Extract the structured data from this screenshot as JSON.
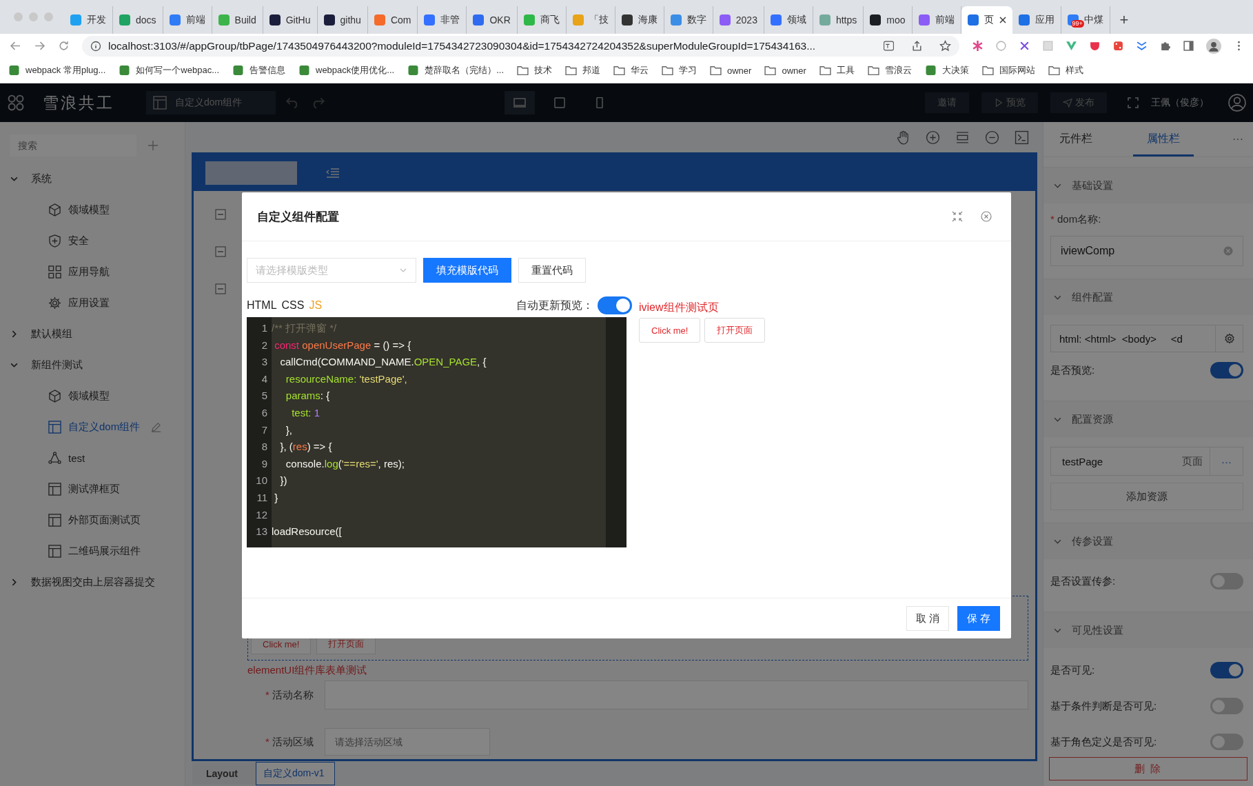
{
  "browser": {
    "tabs": [
      {
        "label": "开发",
        "selected": false,
        "color": "#1ea1f1"
      },
      {
        "label": "docs",
        "selected": false,
        "color": "#1fa463"
      },
      {
        "label": "前端",
        "selected": false,
        "color": "#2f7cf6"
      },
      {
        "label": "Build",
        "selected": false,
        "color": "#3cb44a"
      },
      {
        "label": "GitHu",
        "selected": false,
        "color": "#1b1f3b"
      },
      {
        "label": "githu",
        "selected": false,
        "color": "#1b1f3b"
      },
      {
        "label": "Com",
        "selected": false,
        "color": "#f56b2a"
      },
      {
        "label": "非管",
        "selected": false,
        "color": "#3370ff"
      },
      {
        "label": "OKR",
        "selected": false,
        "color": "#2e6bf0"
      },
      {
        "label": "商飞",
        "selected": false,
        "color": "#2fb84a"
      },
      {
        "label": "「技",
        "selected": false,
        "color": "#e8a317"
      },
      {
        "label": "海康",
        "selected": false,
        "color": "#333333"
      },
      {
        "label": "数字",
        "selected": false,
        "color": "#3a8ee6"
      },
      {
        "label": "2023",
        "selected": false,
        "color": "#8b5cf6"
      },
      {
        "label": "领域",
        "selected": false,
        "color": "#3370ff"
      },
      {
        "label": "https",
        "selected": false,
        "color": "#74aa9c"
      },
      {
        "label": "moo",
        "selected": false,
        "color": "#1b1f23"
      },
      {
        "label": "前端",
        "selected": false,
        "color": "#8b5cf6"
      },
      {
        "label": "页",
        "selected": true,
        "color": "#1f6fe5"
      },
      {
        "label": "应用",
        "selected": false,
        "color": "#1f6fe5"
      },
      {
        "label": "中煤",
        "selected": false,
        "color": "#2f7cf6",
        "badge": "99+"
      }
    ],
    "new_tab": "+",
    "address": "localhost:3103/#/appGroup/tbPage/1743504976443200?moduleId=1754342723090304&id=1754342724204352&superModuleGroupId=175434163...",
    "bookmarks": [
      {
        "label": "webpack 常用plug...",
        "kind": "page"
      },
      {
        "label": "如何写一个webpac...",
        "kind": "page"
      },
      {
        "label": "告警信息",
        "kind": "page"
      },
      {
        "label": "webpack使用优化...",
        "kind": "page"
      },
      {
        "label": "楚辞取名（完结）...",
        "kind": "page"
      },
      {
        "label": "技术",
        "kind": "folder"
      },
      {
        "label": "邦道",
        "kind": "folder"
      },
      {
        "label": "华云",
        "kind": "folder"
      },
      {
        "label": "学习",
        "kind": "folder"
      },
      {
        "label": "owner",
        "kind": "folder"
      },
      {
        "label": "owner",
        "kind": "folder"
      },
      {
        "label": "工具",
        "kind": "folder"
      },
      {
        "label": "雪浪云",
        "kind": "folder"
      },
      {
        "label": "大决策",
        "kind": "page"
      },
      {
        "label": "国际网站",
        "kind": "folder"
      },
      {
        "label": "样式",
        "kind": "folder"
      }
    ]
  },
  "app": {
    "title": "雪浪共工",
    "page_selector": "自定义dom组件",
    "actions": [
      "邀请",
      "预览",
      "发布"
    ],
    "user": "王佩（俊彦）"
  },
  "sidebar": {
    "search_placeholder": "搜索",
    "tree": [
      {
        "label": "系统",
        "expanded": true,
        "children": [
          {
            "label": "领域模型",
            "kind": "model",
            "selected": false
          },
          {
            "label": "安全",
            "kind": "security",
            "selected": false
          },
          {
            "label": "应用导航",
            "kind": "nav",
            "selected": false
          },
          {
            "label": "应用设置",
            "kind": "settings",
            "selected": false
          }
        ]
      },
      {
        "label": "默认模组",
        "expanded": false
      },
      {
        "label": "新组件测试",
        "expanded": true,
        "children": [
          {
            "label": "领域模型",
            "kind": "model",
            "selected": false
          },
          {
            "label": "自定义dom组件",
            "kind": "page",
            "selected": true
          },
          {
            "label": "test",
            "kind": "flow",
            "selected": false
          },
          {
            "label": "测试弹框页",
            "kind": "page",
            "selected": false
          },
          {
            "label": "外部页面测试页",
            "kind": "page",
            "selected": false
          },
          {
            "label": "二维码展示组件",
            "kind": "page",
            "selected": false
          }
        ]
      },
      {
        "label": "数据视图交由上层容器提交",
        "expanded": false
      }
    ]
  },
  "canvas": {
    "preview_buttons": [
      "Click me!",
      "打开页面"
    ],
    "heading": "elementUI组件库表单测试",
    "form": [
      {
        "required_mark": "*",
        "label": "活动名称",
        "kind": "input"
      },
      {
        "required_mark": "*",
        "label": "活动区域",
        "kind": "select",
        "placeholder": "请选择活动区域"
      }
    ],
    "breadcrumb": [
      {
        "label": "Layout",
        "selected": false
      },
      {
        "label": "自定义dom-v1",
        "selected": true
      }
    ]
  },
  "modal": {
    "title": "自定义组件配置",
    "template_placeholder": "请选择模版类型",
    "buttons": [
      {
        "label": "填充模版代码",
        "primary": true
      },
      {
        "label": "重置代码",
        "primary": false
      }
    ],
    "code_tabs": [
      {
        "label": "HTML",
        "selected": false
      },
      {
        "label": "CSS",
        "selected": false
      },
      {
        "label": "JS",
        "selected": true
      }
    ],
    "auto_preview": {
      "label": "自动更新预览：",
      "on": true
    },
    "code_lines": [
      {
        "n": "1",
        "tokens": [
          {
            "t": "/** 打开弹窗 */",
            "color": "#75715e"
          }
        ]
      },
      {
        "n": "2",
        "tokens": [
          {
            "t": " const",
            "color": "#f92672"
          },
          {
            "t": " openUserPage",
            "color": "#fd7a4a"
          },
          {
            "t": " = () => {",
            "color": "#f8f8f2"
          }
        ]
      },
      {
        "n": "3",
        "tokens": [
          {
            "t": "   callCmd(COMMAND_NAME.",
            "color": "#f8f8f2"
          },
          {
            "t": "OPEN_PAGE",
            "color": "#a6e22e"
          },
          {
            "t": ", {",
            "color": "#f8f8f2"
          }
        ]
      },
      {
        "n": "4",
        "tokens": [
          {
            "t": "     resourceName:",
            "color": "#a6e22e"
          },
          {
            "t": " 'testPage',",
            "color": "#e6db74"
          }
        ]
      },
      {
        "n": "5",
        "tokens": [
          {
            "t": "     params",
            "color": "#a6e22e"
          },
          {
            "t": ": {",
            "color": "#f8f8f2"
          }
        ]
      },
      {
        "n": "6",
        "tokens": [
          {
            "t": "       test:",
            "color": "#a6e22e"
          },
          {
            "t": " 1",
            "color": "#ae81ff"
          }
        ]
      },
      {
        "n": "7",
        "tokens": [
          {
            "t": "     },",
            "color": "#f8f8f2"
          }
        ]
      },
      {
        "n": "8",
        "tokens": [
          {
            "t": "   }, (",
            "color": "#f8f8f2"
          },
          {
            "t": "res",
            "color": "#fd7a4a"
          },
          {
            "t": ") => {",
            "color": "#f8f8f2"
          }
        ]
      },
      {
        "n": "9",
        "tokens": [
          {
            "t": "     console.",
            "color": "#f8f8f2"
          },
          {
            "t": "log",
            "color": "#a6e22e"
          },
          {
            "t": "(",
            "color": "#f8f8f2"
          },
          {
            "t": "'==res='",
            "color": "#e6db74"
          },
          {
            "t": ", res);",
            "color": "#f8f8f2"
          }
        ]
      },
      {
        "n": "10",
        "tokens": [
          {
            "t": "   })",
            "color": "#f8f8f2"
          }
        ]
      },
      {
        "n": "11",
        "tokens": [
          {
            "t": " }",
            "color": "#f8f8f2"
          }
        ]
      },
      {
        "n": "12"
      },
      {
        "n": "13",
        "tokens": [
          {
            "t": "loadResource([",
            "color": "#f8f8f2"
          }
        ]
      }
    ],
    "preview": {
      "title": "iview组件测试页",
      "buttons": [
        "Click me!",
        "打开页面"
      ]
    },
    "footer": [
      {
        "label": "取 消",
        "primary": false
      },
      {
        "label": "保 存",
        "primary": true
      }
    ]
  },
  "panel": {
    "tabs": [
      {
        "label": "元件栏",
        "selected": false
      },
      {
        "label": "属性栏",
        "selected": true
      }
    ],
    "more": "···",
    "sections": [
      {
        "title": "基础设置",
        "expanded": true,
        "rows": [
          {
            "kind": "label",
            "required_mark": "*",
            "label": "dom名称:"
          },
          {
            "kind": "input",
            "value": "iviewComp"
          }
        ]
      },
      {
        "title": "组件配置",
        "expanded": true,
        "rows": [
          {
            "kind": "config",
            "value": "html: <html>  <body>     <d"
          },
          {
            "kind": "toggle",
            "label": "是否预览:",
            "on": true
          }
        ]
      },
      {
        "title": "配置资源",
        "expanded": true,
        "rows": [
          {
            "kind": "resource",
            "name": "testPage",
            "type": "页面",
            "more": "···"
          },
          {
            "kind": "add",
            "label": "添加资源"
          }
        ]
      },
      {
        "title": "传参设置",
        "expanded": true,
        "rows": [
          {
            "kind": "toggle",
            "label": "是否设置传参:",
            "on": false
          }
        ]
      },
      {
        "title": "可见性设置",
        "expanded": true,
        "rows": [
          {
            "kind": "toggle",
            "label": "是否可见:",
            "on": true
          },
          {
            "kind": "toggle",
            "label": "基于条件判断是否可见:",
            "on": false
          },
          {
            "kind": "toggle",
            "label": "基于角色定义是否可见:",
            "on": false
          }
        ]
      }
    ],
    "delete_button": "删 除"
  }
}
